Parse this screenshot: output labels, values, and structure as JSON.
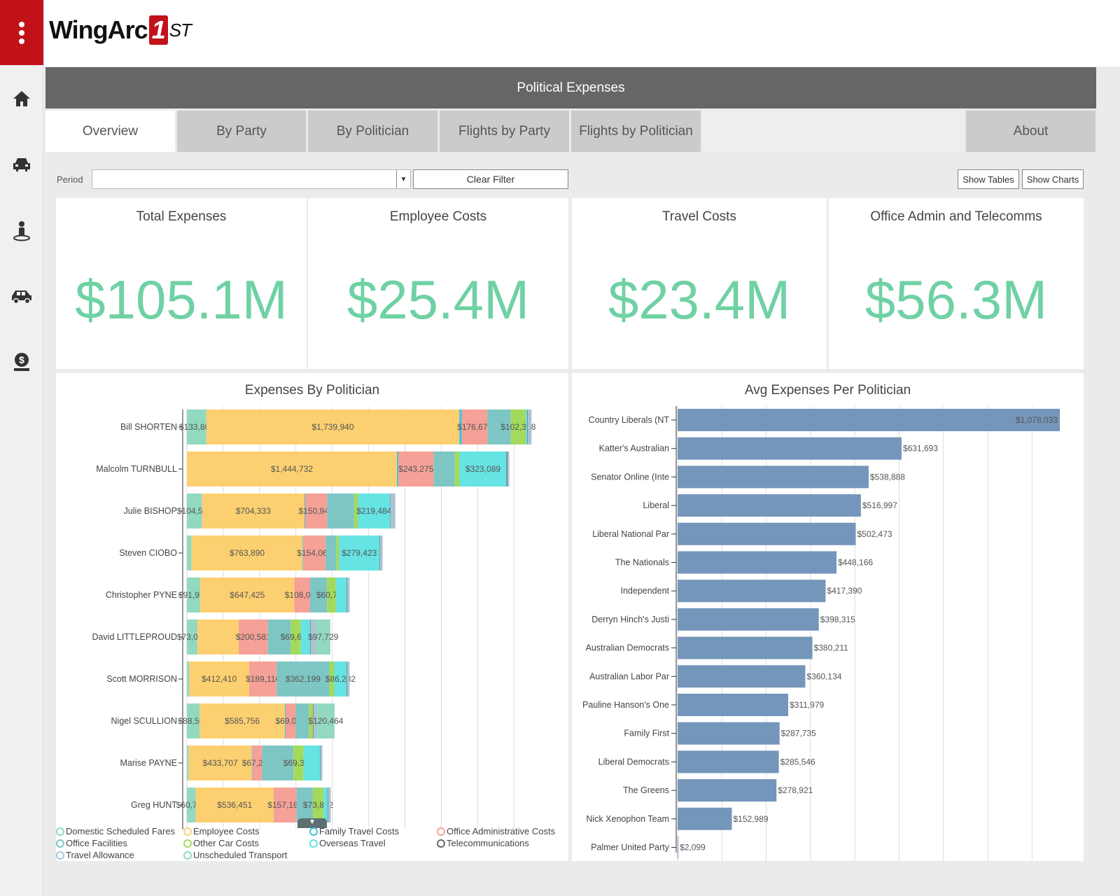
{
  "app": {
    "logo_text": "WingArc",
    "logo_mark": "1",
    "logo_suffix": "ST",
    "title": "Political Expenses"
  },
  "sidebar": {
    "icons": [
      "home-icon",
      "car-front-icon",
      "person-location-icon",
      "car-side-icon",
      "money-bag-icon"
    ]
  },
  "tabs": [
    {
      "label": "Overview",
      "active": true
    },
    {
      "label": "By Party"
    },
    {
      "label": "By Politician"
    },
    {
      "label": "Flights by Party"
    },
    {
      "label": "Flights by Politician"
    },
    {
      "label": "About"
    }
  ],
  "filter": {
    "period_label": "Period",
    "period_value": "",
    "clear_label": "Clear Filter",
    "show_tables": "Show Tables",
    "show_charts": "Show Charts"
  },
  "kpis": [
    {
      "title": "Total Expenses",
      "value": "$105.1M"
    },
    {
      "title": "Employee Costs",
      "value": "$25.4M"
    },
    {
      "title": "Travel Costs",
      "value": "$23.4M"
    },
    {
      "title": "Office Admin and Telecomms",
      "value": "$56.3M"
    }
  ],
  "colors": {
    "accent": "#c1121a",
    "kpi": "#6fd1a4",
    "bar": "#7596bb"
  },
  "chart_data": [
    {
      "type": "bar",
      "stacked": true,
      "orientation": "horizontal",
      "title": "Expenses By Politician",
      "xlim": [
        0,
        2470000
      ],
      "grid": true,
      "legend_placement": "bottom",
      "series": [
        {
          "name": "Domestic Scheduled Fares",
          "color": "#93d9bf"
        },
        {
          "name": "Employee Costs",
          "color": "#fcd070"
        },
        {
          "name": "Family Travel Costs",
          "color": "#47c0e0"
        },
        {
          "name": "Office Administrative Costs",
          "color": "#f5a197"
        },
        {
          "name": "Office Facilities",
          "color": "#7ec6c4"
        },
        {
          "name": "Other Car Costs",
          "color": "#a3d95c"
        },
        {
          "name": "Overseas Travel",
          "color": "#66e3e3"
        },
        {
          "name": "Telecommunications",
          "color": "#666666"
        },
        {
          "name": "Travel Allowance",
          "color": "#a9c4d4"
        },
        {
          "name": "Unscheduled Transport",
          "color": "#93d9bf"
        }
      ],
      "categories": [
        "Bill SHORTEN",
        "Malcolm TURNBULL",
        "Julie BISHOP",
        "Steven CIOBO",
        "Christopher PYNE",
        "David LITTLEPROUD",
        "Scott MORRISON",
        "Nigel SCULLION",
        "Marise PAYNE",
        "Greg HUNT"
      ],
      "values": [
        [
          133868,
          1739940,
          17600,
          176671,
          160000,
          102378,
          11000,
          4000,
          25000,
          0
        ],
        [
          0,
          1444732,
          9600,
          243275,
          145600,
          32000,
          323089,
          6400,
          12800,
          0
        ],
        [
          104543,
          704333,
          4800,
          150943,
          185600,
          27200,
          219484,
          2000,
          35200,
          0
        ],
        [
          32000,
          763890,
          4800,
          154065,
          72000,
          19200,
          279423,
          3200,
          17600,
          0
        ],
        [
          91970,
          647425,
          0,
          108028,
          116800,
          60742,
          75200,
          3200,
          16000,
          0
        ],
        [
          73088,
          283200,
          0,
          200581,
          156800,
          69605,
          64000,
          3200,
          38400,
          97729
        ],
        [
          16000,
          412410,
          0,
          189116,
          362199,
          33600,
          86282,
          3200,
          16000,
          0
        ],
        [
          88504,
          585756,
          4800,
          69086,
          91200,
          27200,
          0,
          3200,
          25600,
          120464
        ],
        [
          12800,
          433707,
          3200,
          67251,
          216000,
          69352,
          115200,
          3200,
          11200,
          0
        ],
        [
          60734,
          536451,
          0,
          157189,
          112000,
          73862,
          27200,
          3200,
          19200,
          0
        ]
      ],
      "data_labels": [
        [
          0,
          1,
          3,
          5
        ],
        [
          1,
          3,
          6
        ],
        [
          0,
          1,
          3,
          6
        ],
        [
          1,
          3,
          6
        ],
        [
          0,
          1,
          3,
          5
        ],
        [
          0,
          3,
          5,
          9
        ],
        [
          1,
          3,
          4,
          6
        ],
        [
          0,
          1,
          3,
          9
        ],
        [
          1,
          3,
          5
        ],
        [
          0,
          1,
          3,
          5
        ]
      ]
    },
    {
      "type": "bar",
      "orientation": "horizontal",
      "title": "Avg Expenses Per Politician",
      "xlim": [
        0,
        1080000
      ],
      "grid": true,
      "categories": [
        "Country Liberals (NT",
        "Katter's Australian ",
        "Senator Online (Inte",
        "Liberal",
        "Liberal National Par",
        "The Nationals",
        "Independent",
        "Derryn Hinch's Justi",
        "Australian Democrats",
        "Australian Labor Par",
        "Pauline Hanson's One",
        "Family First",
        "Liberal Democrats",
        "The Greens",
        "Nick Xenophon Team",
        "Palmer United Party"
      ],
      "values": [
        1078033,
        631693,
        538888,
        516997,
        502473,
        448166,
        417390,
        398315,
        380211,
        360134,
        311979,
        287735,
        285546,
        278921,
        152989,
        2099
      ],
      "labels": [
        "$1,078,033",
        "$631,693",
        "$538,888",
        "$516,997",
        "$502,473",
        "$448,166",
        "$417,390",
        "$398,315",
        "$380,211",
        "$360,134",
        "$311,979",
        "$287,735",
        "$285,546",
        "$278,921",
        "$152,989",
        "$2,099"
      ]
    }
  ]
}
